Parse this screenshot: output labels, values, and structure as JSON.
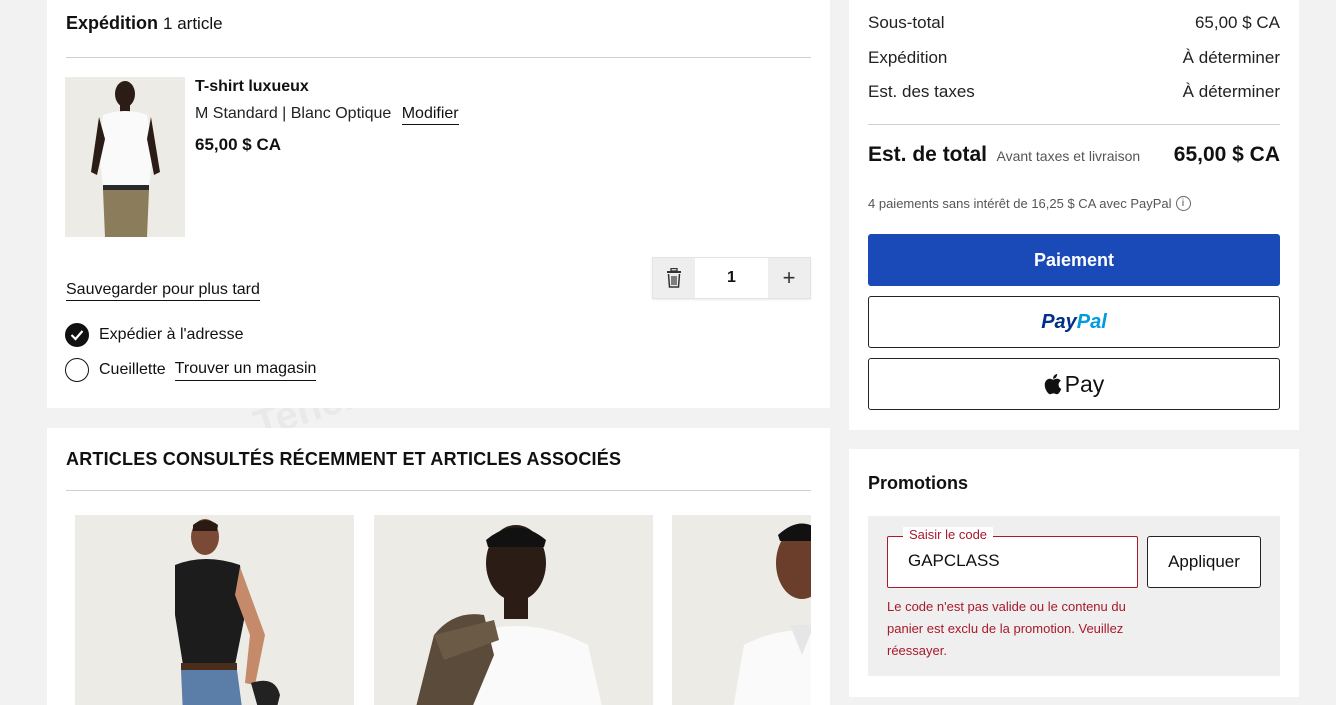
{
  "shipping": {
    "title": "Expédition",
    "count": "1 article",
    "product": {
      "name": "T-shirt luxueux",
      "variant": "M Standard | Blanc Optique",
      "modify": "Modifier",
      "price": "65,00 $ CA",
      "quantity": "1"
    },
    "save_later": "Sauvegarder pour plus tard",
    "option_ship": "Expédier à l'adresse",
    "option_pickup": "Cueillette",
    "find_store": "Trouver un magasin"
  },
  "recent": {
    "title": "ARTICLES CONSULTÉS RÉCEMMENT ET ARTICLES ASSOCIÉS"
  },
  "summary": {
    "subtotal_label": "Sous-total",
    "subtotal_value": "65,00 $ CA",
    "shipping_label": "Expédition",
    "shipping_value": "À déterminer",
    "taxes_label": "Est. des taxes",
    "taxes_value": "À déterminer",
    "total_label": "Est. de total",
    "total_sub": "Avant taxes et livraison",
    "total_value": "65,00 $ CA",
    "paypal_note": "4 paiements sans intérêt de 16,25 $ CA avec PayPal",
    "checkout": "Paiement",
    "paypal_pay": "Pay",
    "paypal_pal": "Pal",
    "applepay": "Pay"
  },
  "promo": {
    "title": "Promotions",
    "field_label": "Saisir le code",
    "code": "GAPCLASS",
    "apply": "Appliquer",
    "error": "Le code n'est pas valide ou le contenu du panier est exclu de la promotion. Veuillez réessayer."
  },
  "colors": {
    "checkout_blue": "#1a4ab7",
    "error_red": "#a8192b",
    "paypal_dark": "#003087",
    "paypal_light": "#009cde"
  }
}
